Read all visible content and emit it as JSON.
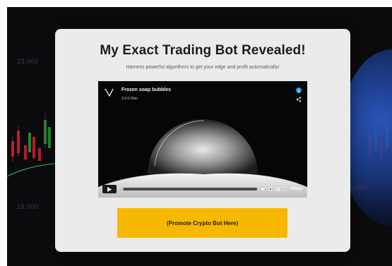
{
  "modal": {
    "title": "My Exact Trading Bot Revealed!",
    "subtitle": "Harness powerful algorithms to get your edge and profit automatically!",
    "cta_label": "(Promote Crypto Bot Here)"
  },
  "video": {
    "title": "Frozen soap bubbles",
    "byline": "2.6.0 Ohio",
    "progress": 0.02,
    "brand": "vimeo"
  },
  "background": {
    "price_labels": [
      "23,000",
      "21,000",
      "19,000"
    ]
  },
  "colors": {
    "modal_bg": "#ebebeb",
    "cta": "#f7b800",
    "progress_fill": "#9ad9ff",
    "badge": "#1e9bd7"
  },
  "icons": [
    "vimeo-logo-icon",
    "info-icon",
    "share-icon",
    "play-icon",
    "volume-icon",
    "settings-icon",
    "pip-icon",
    "fullscreen-icon"
  ]
}
